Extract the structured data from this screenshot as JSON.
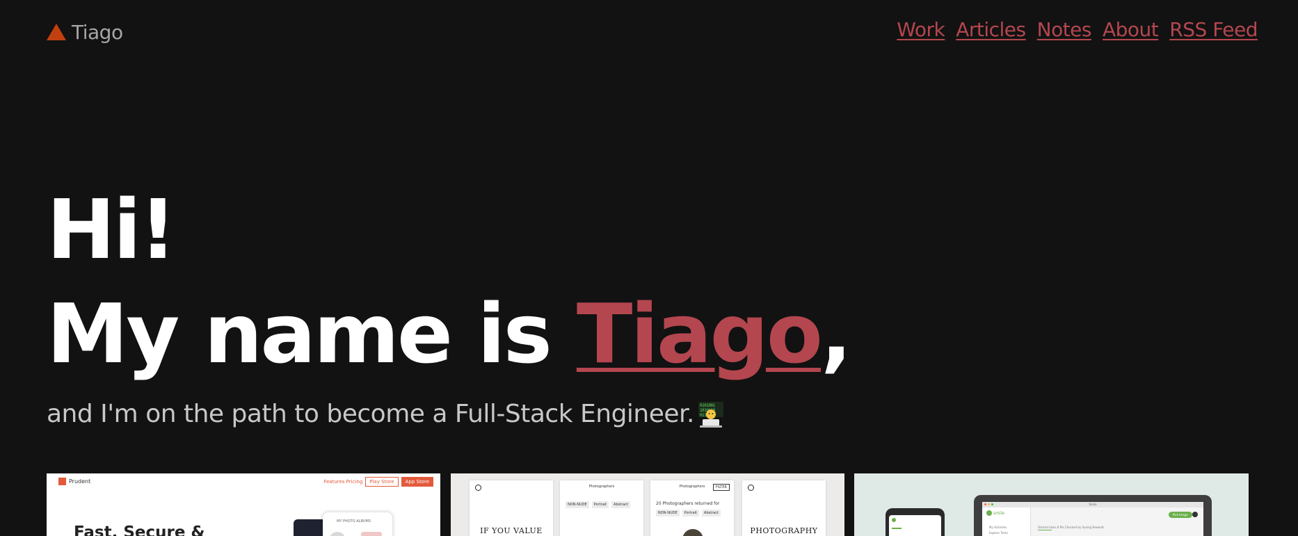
{
  "header": {
    "logo_text": "Tiago",
    "nav": [
      {
        "label": "Work"
      },
      {
        "label": "Articles"
      },
      {
        "label": "Notes"
      },
      {
        "label": "About"
      },
      {
        "label": "RSS Feed"
      }
    ]
  },
  "colors": {
    "background": "#121212",
    "accent": "#b4464f",
    "logo_triangle": "#c1400f",
    "heading": "#ffffff",
    "subtitle": "#c8c8c8"
  },
  "hero": {
    "greeting": "Hi!",
    "intro_prefix": "My name is ",
    "name": "Tiago",
    "intro_suffix": ",",
    "subtitle": "and I'm on the path to become a Full-Stack Engineer.",
    "subtitle_icon": "technologist-emoji-icon"
  },
  "projects": [
    {
      "brand": "Prudent",
      "nav_links": "Features  Pricing",
      "button_outline": "Play Store",
      "button_fill": "App Store",
      "headline": "Fast, Secure &",
      "phone_title": "MY PHOTO ALBUMS"
    },
    {
      "panels": [
        {
          "serif_text": "If You Value\nYour Work"
        },
        {
          "title": "Photographers",
          "tags": [
            "NON-NUDE",
            "Portrait",
            "Abstract"
          ]
        },
        {
          "title": "Photographers",
          "filter": "FILTER",
          "count": "20 Photographers returned for",
          "tags": [
            "NON-NUDE",
            "Portrait",
            "Abstract"
          ]
        },
        {
          "serif_text": "Photography\nthe new way"
        }
      ]
    },
    {
      "app_name": "smile",
      "url": "Smile",
      "sidebar_items": [
        "My Activities",
        "Explore Tasks"
      ],
      "pill": "Pick Image",
      "tabs": "Started tasks   8 Pts   Checked by   Saving Rewards"
    }
  ]
}
